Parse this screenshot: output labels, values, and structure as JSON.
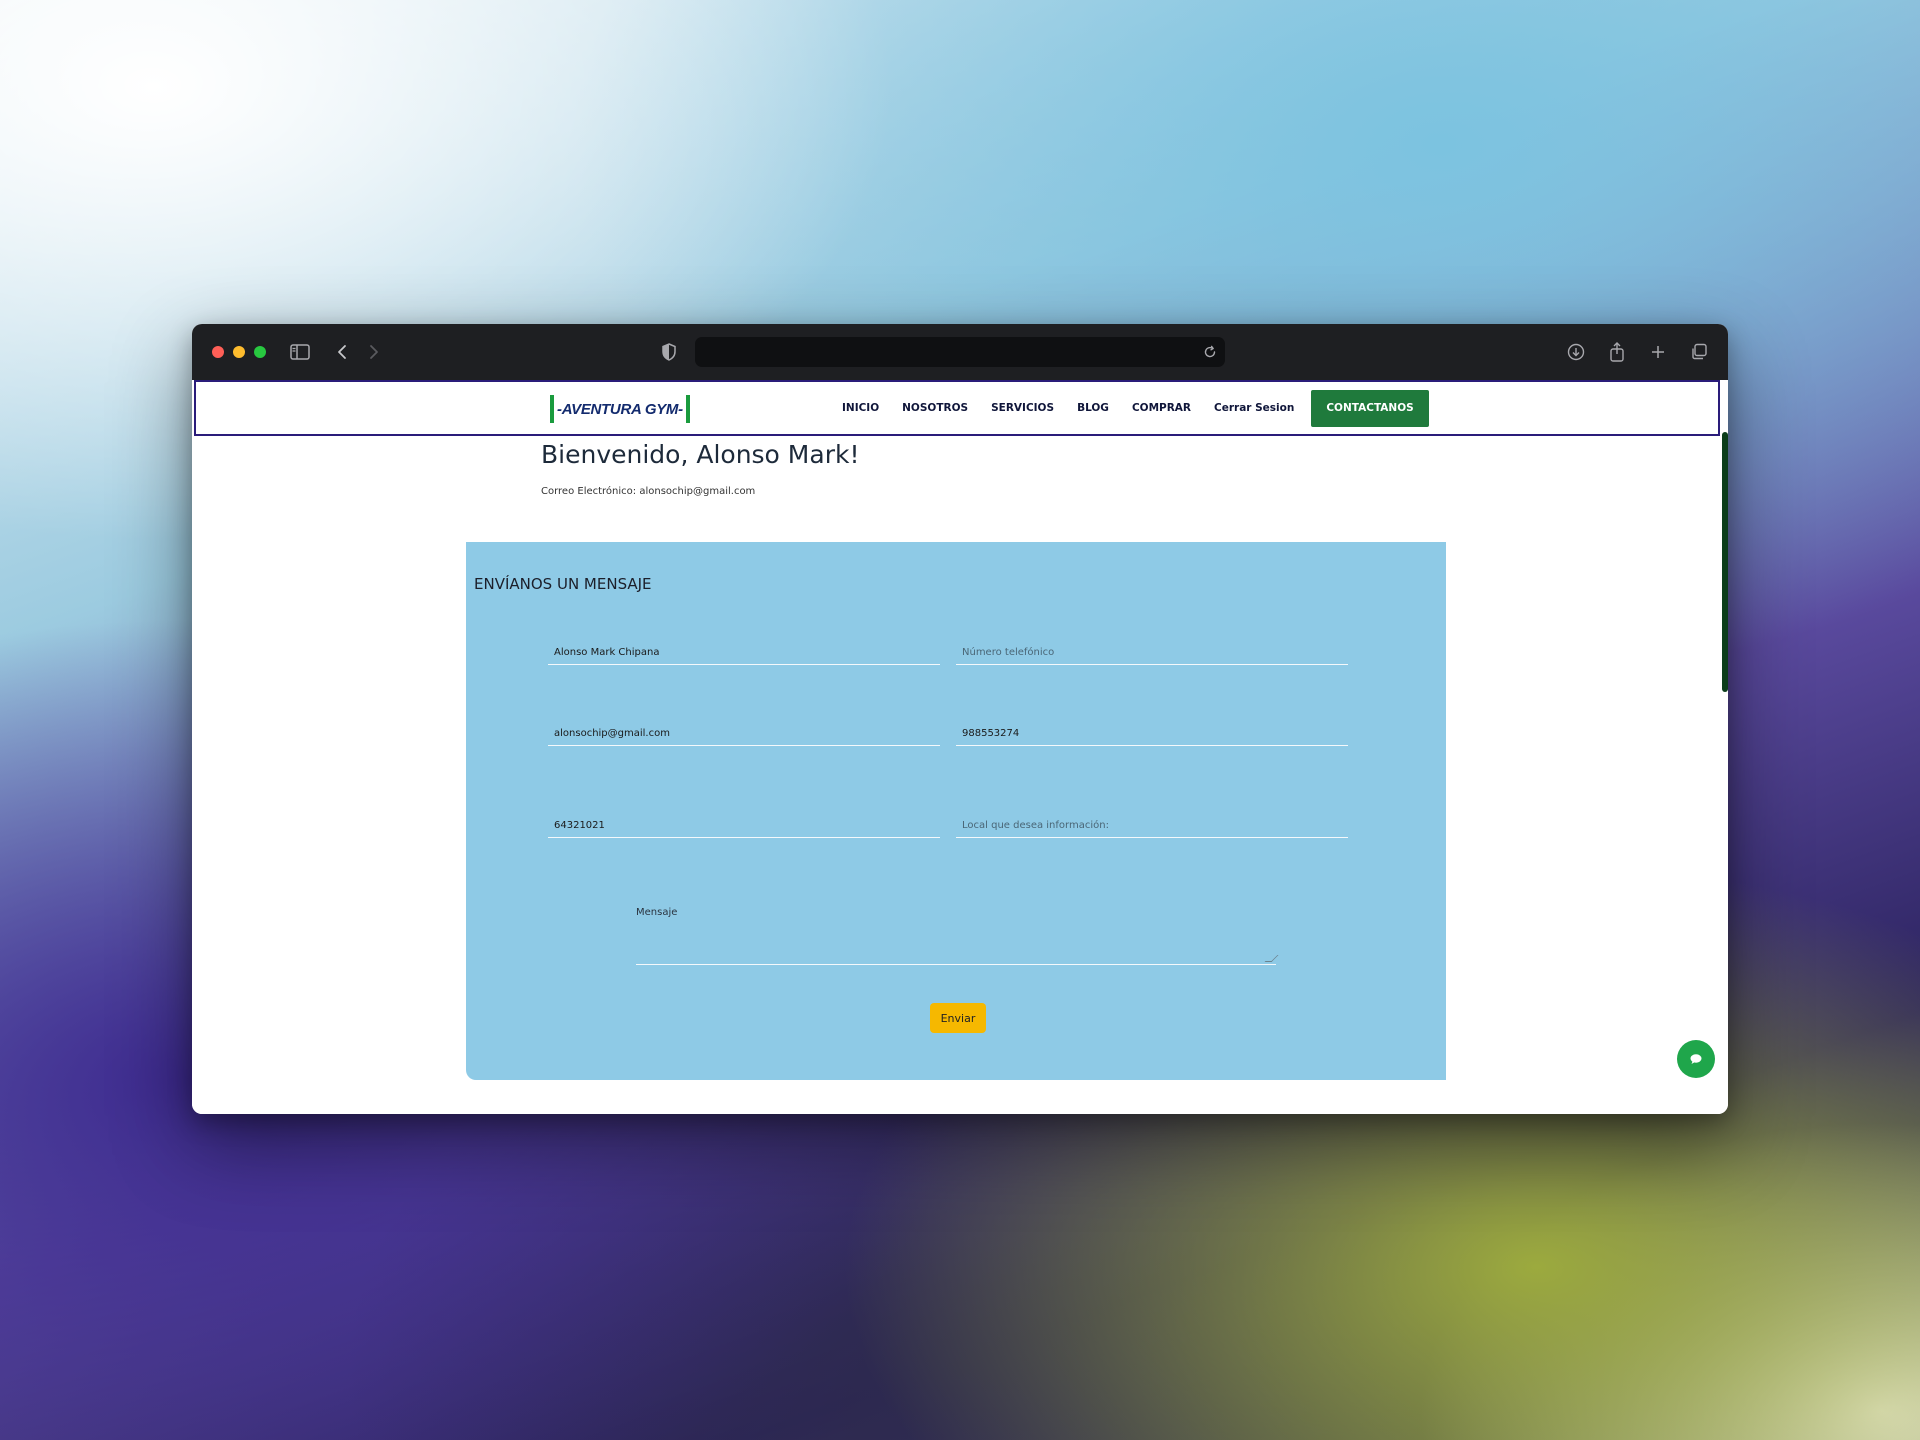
{
  "browser": {
    "url": "",
    "icons": [
      "sidebar-icon",
      "back-icon",
      "forward-icon",
      "shield-icon",
      "reload-icon",
      "download-icon",
      "share-icon",
      "new-tab-icon",
      "tabs-overview-icon"
    ]
  },
  "brand": {
    "logo_text": "-AVENTURA GYM-",
    "primary_green": "#1f7a3c",
    "nav_border": "#2a1c7a",
    "form_bg": "#8ecae6",
    "button_yellow": "#f6b800"
  },
  "nav": {
    "items": [
      {
        "label": "INICIO"
      },
      {
        "label": "NOSOTROS"
      },
      {
        "label": "SERVICIOS"
      },
      {
        "label": "BLOG"
      },
      {
        "label": "COMPRAR"
      },
      {
        "label": "Cerrar Sesion"
      }
    ],
    "cta_label": "CONTACTANOS"
  },
  "welcome": {
    "heading": "Bienvenido, Alonso Mark!",
    "email_line": "Correo Electrónico: alonsochip@gmail.com"
  },
  "form": {
    "title": "ENVÍANOS UN MENSAJE",
    "name_value": "Alonso Mark Chipana",
    "phone_placeholder": "Número telefónico",
    "phone_value": "",
    "email_value": "alonsochip@gmail.com",
    "phone2_value": "988553274",
    "dni_value": "64321021",
    "local_placeholder": "Local que desea información:",
    "message_placeholder": "Mensaje",
    "submit_label": "Enviar"
  }
}
